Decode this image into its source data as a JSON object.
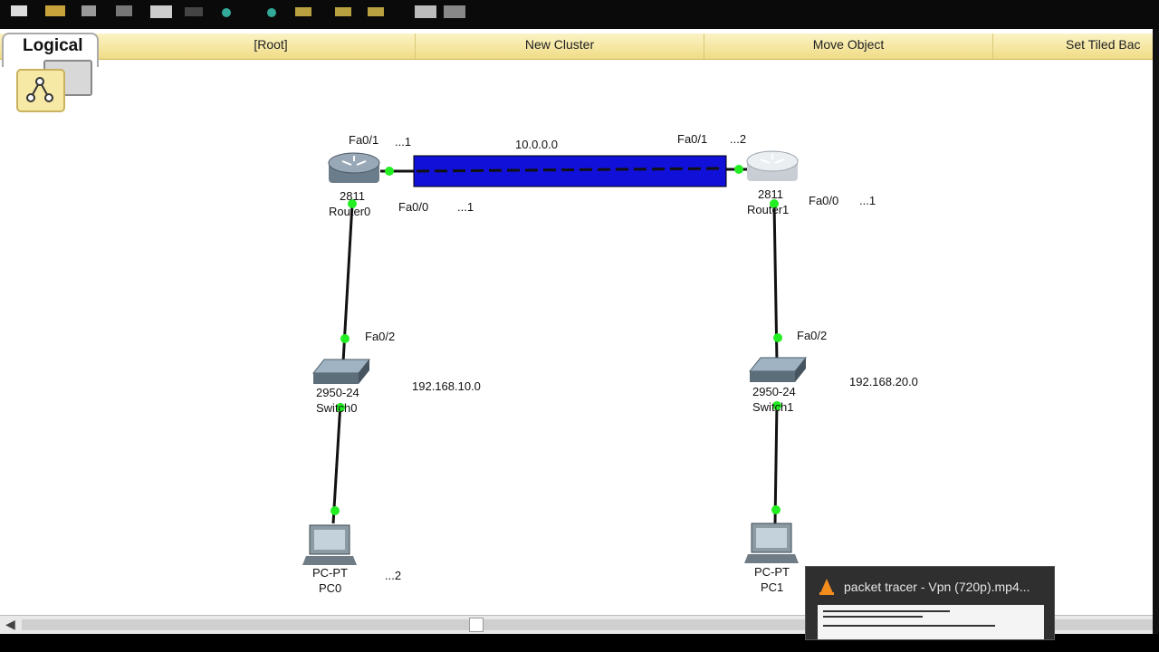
{
  "modebar": {
    "tab_label": "Logical",
    "items": [
      "[Root]",
      "New Cluster",
      "Move Object",
      "Set Tiled Bac"
    ]
  },
  "devices": {
    "router0": {
      "model": "2811",
      "name": "Router0"
    },
    "router1": {
      "model": "2811",
      "name": "Router1"
    },
    "switch0": {
      "model": "2950-24",
      "name": "Switch0"
    },
    "switch1": {
      "model": "2950-24",
      "name": "Switch1"
    },
    "pc0": {
      "model": "PC-PT",
      "name": "PC0"
    },
    "pc1": {
      "model": "PC-PT",
      "name": "PC1"
    }
  },
  "labels": {
    "r0_fa01": "Fa0/1",
    "r0_fa01_ip": "...1",
    "r0_fa00": "Fa0/0",
    "r0_fa00_ip": "...1",
    "r1_fa01": "Fa0/1",
    "r1_fa01_ip": "...2",
    "r1_fa00": "Fa0/0",
    "r1_fa00_ip": "...1",
    "sw0_fa02": "Fa0/2",
    "sw1_fa02": "Fa0/2",
    "wan_net": "10.0.0.0",
    "lan0_net": "192.168.10.0",
    "lan1_net": "192.168.20.0",
    "pc0_ip": "...2"
  },
  "colors": {
    "wan_link": "#1010d8",
    "port_up": "#22ee22",
    "cable": "#111111"
  },
  "icons": {
    "logical_nav": "topology-icon"
  },
  "popup": {
    "title": "packet tracer - Vpn (720p).mp4..."
  }
}
